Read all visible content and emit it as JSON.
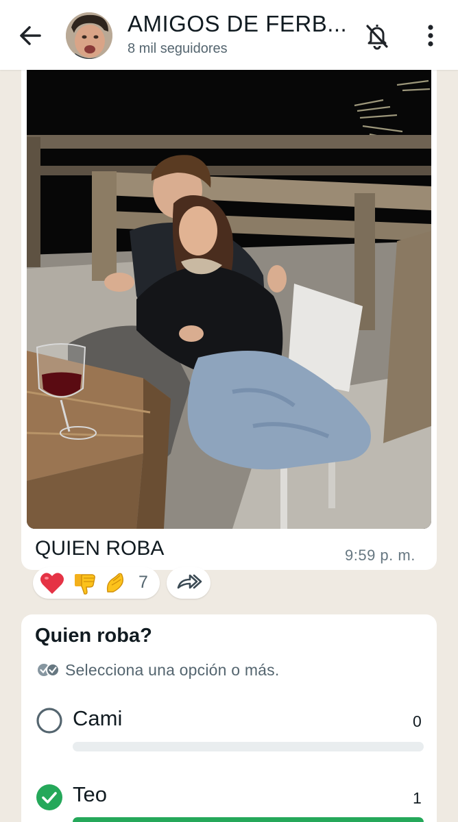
{
  "header": {
    "title": "AMIGOS DE FERB...",
    "subtitle": "8 mil seguidores",
    "back_icon": "arrow-left-icon",
    "mute_icon": "bell-off-icon",
    "menu_icon": "more-vertical-icon"
  },
  "message": {
    "caption": "QUIEN ROBA",
    "time": "9:59 p. m.",
    "reactions": [
      "❤️",
      "👎",
      "🤌"
    ],
    "reaction_count": "7",
    "forward_icon": "forward-icon"
  },
  "poll": {
    "question": "Quien roba?",
    "hint": "Selecciona una opción o más.",
    "options": [
      {
        "label": "Cami",
        "count": "0",
        "selected": false,
        "fill_fraction": 0
      },
      {
        "label": "Teo",
        "count": "1",
        "selected": true,
        "fill_fraction": 1
      }
    ]
  },
  "colors": {
    "accent": "#25a85a",
    "background": "#efeae2",
    "bubble": "#ffffff"
  }
}
